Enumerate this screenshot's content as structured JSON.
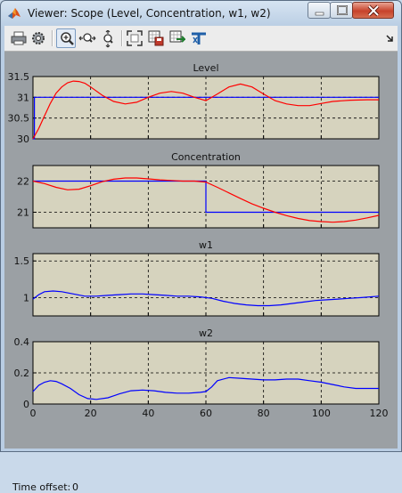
{
  "window": {
    "title": "Viewer: Scope (Level, Concentration, w1, w2)",
    "controls": [
      "minimize",
      "maximize",
      "close"
    ]
  },
  "toolbar": {
    "buttons": [
      {
        "icon": "print-icon"
      },
      {
        "icon": "parameters-icon"
      },
      {
        "icon": "zoom-in-icon",
        "active": true
      },
      {
        "icon": "zoom-x-icon"
      },
      {
        "icon": "zoom-y-icon"
      },
      {
        "icon": "autoscale-icon"
      },
      {
        "icon": "save-axes-settings-icon"
      },
      {
        "icon": "restore-axes-settings-icon"
      },
      {
        "icon": "floating-scope-icon"
      },
      {
        "icon": "dock-arrow-icon"
      }
    ]
  },
  "colors": {
    "axes_background": "#d6d3be",
    "figure_background": "#9ba0a4",
    "signal": "#ff0000",
    "reference": "#0000ff"
  },
  "status": {
    "time_offset_label": "Time offset:",
    "time_offset_value": "0"
  },
  "chart_data": [
    {
      "type": "line",
      "title": "Level",
      "xlim": [
        0,
        120
      ],
      "ylim": [
        30,
        31.5
      ],
      "yticks": [
        "30",
        "30.5",
        "31",
        "31.5"
      ],
      "xtick_labels_shown": false,
      "grid": true,
      "series": [
        {
          "color": "#0000ff",
          "x": [
            0,
            0.5,
            0.5,
            120
          ],
          "y": [
            30,
            30,
            31,
            31
          ]
        },
        {
          "color": "#ff0000",
          "x": [
            0,
            2,
            4,
            6,
            8,
            10,
            12,
            14,
            16,
            18,
            20,
            24,
            28,
            32,
            36,
            40,
            44,
            48,
            52,
            56,
            60,
            64,
            68,
            72,
            76,
            80,
            84,
            88,
            92,
            96,
            100,
            104,
            110,
            116,
            120
          ],
          "y": [
            30,
            30.25,
            30.55,
            30.85,
            31.1,
            31.25,
            31.35,
            31.39,
            31.38,
            31.34,
            31.25,
            31.05,
            30.9,
            30.84,
            30.88,
            31.0,
            31.1,
            31.14,
            31.1,
            31.0,
            30.92,
            31.08,
            31.25,
            31.32,
            31.25,
            31.08,
            30.92,
            30.84,
            30.8,
            30.8,
            30.85,
            30.9,
            30.93,
            30.94,
            30.94
          ]
        }
      ]
    },
    {
      "type": "line",
      "title": "Concentration",
      "xlim": [
        0,
        120
      ],
      "ylim": [
        20.5,
        22.5
      ],
      "yticks": [
        "21",
        "22"
      ],
      "xtick_labels_shown": false,
      "grid": true,
      "series": [
        {
          "color": "#0000ff",
          "x": [
            0,
            60,
            60,
            120
          ],
          "y": [
            22,
            22,
            21,
            21
          ]
        },
        {
          "color": "#ff0000",
          "x": [
            0,
            4,
            8,
            12,
            16,
            20,
            24,
            28,
            32,
            36,
            40,
            44,
            48,
            52,
            56,
            60,
            64,
            68,
            72,
            76,
            80,
            84,
            88,
            92,
            96,
            100,
            104,
            108,
            112,
            116,
            120
          ],
          "y": [
            22,
            21.92,
            21.8,
            21.72,
            21.74,
            21.85,
            21.98,
            22.06,
            22.1,
            22.1,
            22.07,
            22.04,
            22.02,
            22.0,
            22.0,
            21.97,
            21.8,
            21.62,
            21.44,
            21.27,
            21.13,
            21.0,
            20.89,
            20.8,
            20.73,
            20.7,
            20.68,
            20.7,
            20.75,
            20.82,
            20.9
          ]
        }
      ]
    },
    {
      "type": "line",
      "title": "w1",
      "xlim": [
        0,
        120
      ],
      "ylim": [
        0.75,
        1.6
      ],
      "yticks": [
        "1",
        "1.5"
      ],
      "xtick_labels_shown": false,
      "grid": true,
      "series": [
        {
          "color": "#0000ff",
          "x": [
            0,
            2,
            4,
            7,
            10,
            14,
            18,
            22,
            26,
            30,
            34,
            38,
            42,
            46,
            50,
            54,
            58,
            62,
            66,
            70,
            74,
            78,
            82,
            86,
            90,
            94,
            98,
            102,
            106,
            110,
            114,
            120
          ],
          "y": [
            0.98,
            1.04,
            1.08,
            1.09,
            1.08,
            1.05,
            1.02,
            1.02,
            1.03,
            1.04,
            1.05,
            1.05,
            1.04,
            1.03,
            1.02,
            1.02,
            1.01,
            0.99,
            0.95,
            0.92,
            0.9,
            0.89,
            0.89,
            0.9,
            0.92,
            0.94,
            0.96,
            0.97,
            0.98,
            0.99,
            1.0,
            1.02
          ]
        }
      ]
    },
    {
      "type": "line",
      "title": "w2",
      "xlim": [
        0,
        120
      ],
      "ylim": [
        0,
        0.4
      ],
      "yticks": [
        "0",
        "0.2",
        "0.4"
      ],
      "xticks": [
        "0",
        "20",
        "40",
        "60",
        "80",
        "100",
        "120"
      ],
      "grid": true,
      "series": [
        {
          "color": "#0000ff",
          "x": [
            0,
            2,
            4,
            6,
            8,
            10,
            13,
            16,
            19,
            22,
            26,
            30,
            34,
            38,
            42,
            46,
            50,
            54,
            58,
            60,
            62,
            64,
            68,
            72,
            76,
            80,
            84,
            88,
            92,
            96,
            100,
            104,
            108,
            112,
            116,
            120
          ],
          "y": [
            0.08,
            0.12,
            0.14,
            0.15,
            0.145,
            0.13,
            0.1,
            0.06,
            0.035,
            0.03,
            0.04,
            0.065,
            0.085,
            0.09,
            0.085,
            0.075,
            0.07,
            0.07,
            0.075,
            0.08,
            0.11,
            0.15,
            0.17,
            0.165,
            0.16,
            0.155,
            0.155,
            0.16,
            0.16,
            0.15,
            0.14,
            0.125,
            0.11,
            0.1,
            0.1,
            0.1
          ]
        }
      ]
    }
  ]
}
